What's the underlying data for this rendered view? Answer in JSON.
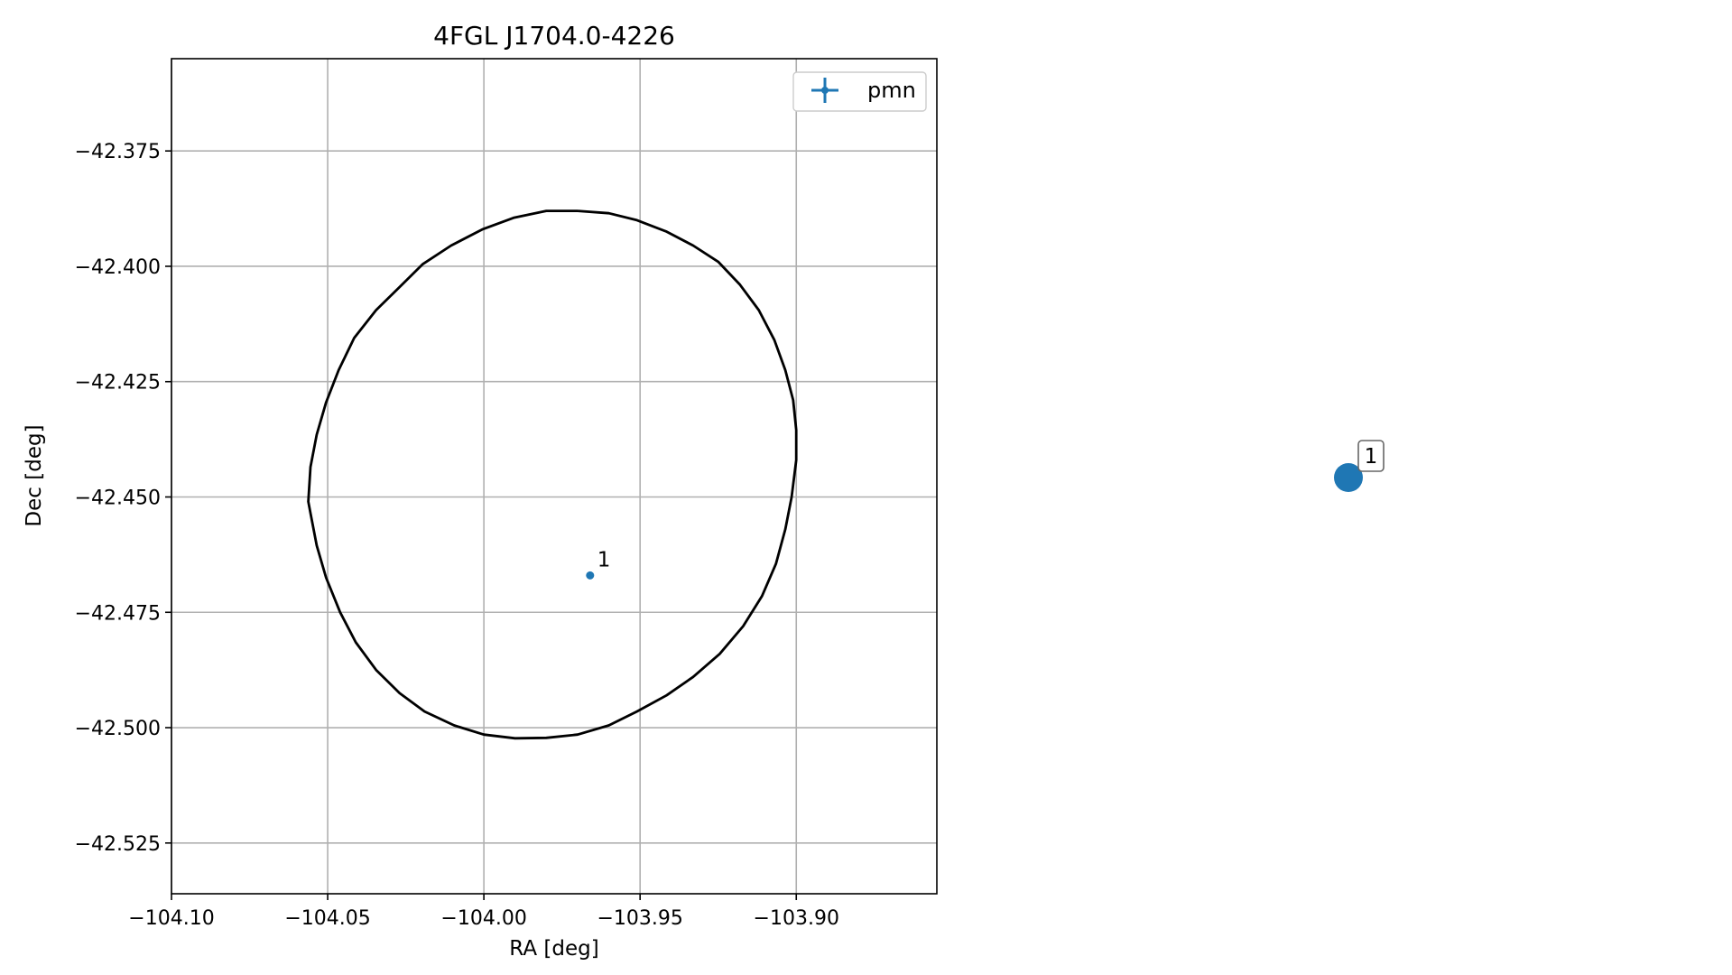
{
  "chart_data": {
    "type": "scatter",
    "title": "4FGL J1704.0-4226",
    "xlabel": "RA [deg]",
    "ylabel": "Dec [deg]",
    "xlim": [
      -104.1,
      -103.855
    ],
    "ylim": [
      -42.536,
      -42.355
    ],
    "xticks": [
      -104.1,
      -104.05,
      -104.0,
      -103.95,
      -103.9
    ],
    "xtick_labels": [
      "−104.10",
      "−104.05",
      "−104.00",
      "−103.95",
      "−103.90"
    ],
    "yticks": [
      -42.375,
      -42.4,
      -42.425,
      -42.45,
      -42.475,
      -42.5,
      -42.525
    ],
    "ytick_labels": [
      "−42.375",
      "−42.400",
      "−42.425",
      "−42.450",
      "−42.475",
      "−42.500",
      "−42.525"
    ],
    "grid": true,
    "legend": {
      "placement": "top-right",
      "entries": [
        "pmn"
      ]
    },
    "series": [
      {
        "name": "pmn",
        "color": "#1f77b4",
        "points": [
          {
            "x": -103.966,
            "y": -42.467,
            "label": "1"
          }
        ]
      }
    ],
    "ellipse": {
      "color": "#000000",
      "points": [
        [
          -103.97,
          -42.388
        ],
        [
          -103.96,
          -42.3885
        ],
        [
          -103.951,
          -42.39
        ],
        [
          -103.9415,
          -42.3925
        ],
        [
          -103.933,
          -42.3955
        ],
        [
          -103.925,
          -42.399
        ],
        [
          -103.918,
          -42.404
        ],
        [
          -103.912,
          -42.4095
        ],
        [
          -103.907,
          -42.416
        ],
        [
          -103.9035,
          -42.4225
        ],
        [
          -103.901,
          -42.429
        ],
        [
          -103.9,
          -42.4355
        ],
        [
          -103.9,
          -42.442
        ],
        [
          -103.9015,
          -42.45
        ],
        [
          -103.9035,
          -42.457
        ],
        [
          -103.9065,
          -42.4645
        ],
        [
          -103.911,
          -42.4715
        ],
        [
          -103.917,
          -42.478
        ],
        [
          -103.9245,
          -42.484
        ],
        [
          -103.933,
          -42.489
        ],
        [
          -103.9415,
          -42.493
        ],
        [
          -103.951,
          -42.4965
        ],
        [
          -103.96,
          -42.4995
        ],
        [
          -103.97,
          -42.5015
        ],
        [
          -103.98,
          -42.5022
        ],
        [
          -103.99,
          -42.5023
        ],
        [
          -104.0,
          -42.5015
        ],
        [
          -104.0095,
          -42.4995
        ],
        [
          -104.019,
          -42.4965
        ],
        [
          -104.027,
          -42.4925
        ],
        [
          -104.0345,
          -42.4875
        ],
        [
          -104.041,
          -42.4815
        ],
        [
          -104.046,
          -42.475
        ],
        [
          -104.0505,
          -42.4675
        ],
        [
          -104.0535,
          -42.4605
        ],
        [
          -104.0555,
          -42.4535
        ],
        [
          -104.0562,
          -42.451
        ],
        [
          -104.0555,
          -42.4435
        ],
        [
          -104.0535,
          -42.4365
        ],
        [
          -104.0505,
          -42.4295
        ],
        [
          -104.0465,
          -42.4225
        ],
        [
          -104.0415,
          -42.4155
        ],
        [
          -104.0345,
          -42.4095
        ],
        [
          -104.027,
          -42.4045
        ],
        [
          -104.0195,
          -42.3995
        ],
        [
          -104.0105,
          -42.3955
        ],
        [
          -104.0005,
          -42.392
        ],
        [
          -103.9905,
          -42.3895
        ],
        [
          -103.98,
          -42.388
        ],
        [
          -103.97,
          -42.388
        ]
      ]
    }
  },
  "secondary_marker": {
    "label": "1",
    "color": "#1f77b4"
  }
}
